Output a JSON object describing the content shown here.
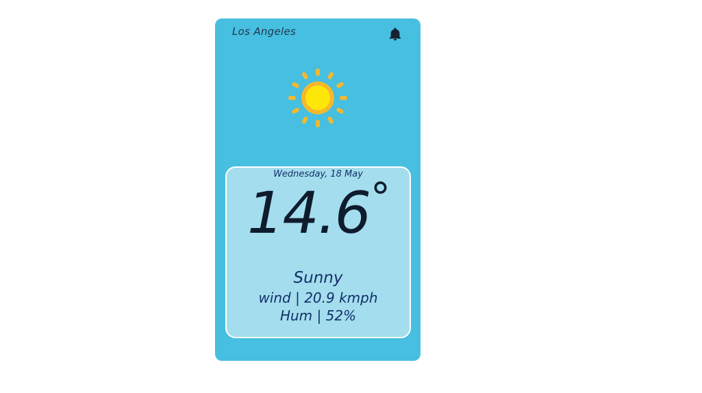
{
  "location": {
    "city": "Los Angeles"
  },
  "icons": {
    "notification": "bell-icon",
    "weather": "sun-icon"
  },
  "weather": {
    "date": "Wednesday, 18 May",
    "temperature": "14.6",
    "degree_symbol": "°",
    "condition": "Sunny",
    "wind": "wind | 20.9 kmph",
    "humidity": "Hum | 52%"
  },
  "colors": {
    "card_bg": "#47bfe0",
    "panel_bg": "#a4dded",
    "sun_outer": "#f5b82e",
    "sun_inner": "#ffe60a"
  }
}
